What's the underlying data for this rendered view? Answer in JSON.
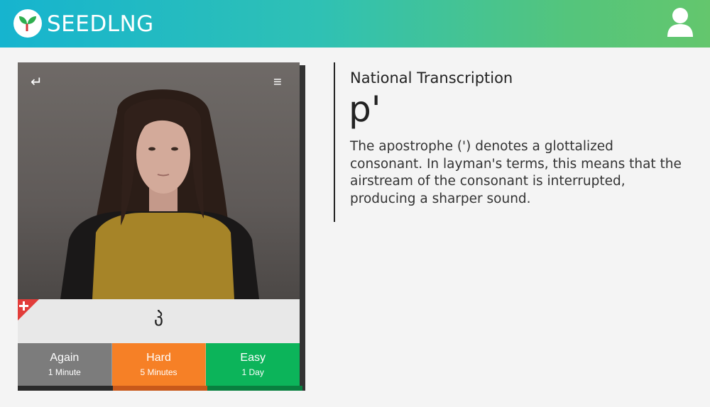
{
  "header": {
    "logo_text": "SEEDLNG",
    "logo_icon": "seedling-icon",
    "user_icon": "user-icon",
    "gradient_colors": [
      "#16b4cf",
      "#64c66d"
    ]
  },
  "card": {
    "back_icon": "return-arrow-icon",
    "menu_icon": "hamburger-menu-icon",
    "caption": "პ",
    "flag_icon": "georgian-flag-icon",
    "ratings": [
      {
        "label": "Again",
        "interval": "1 Minute",
        "color": "#7c7c7c"
      },
      {
        "label": "Hard",
        "interval": "5 Minutes",
        "color": "#f68026"
      },
      {
        "label": "Easy",
        "interval": "1 Day",
        "color": "#0cb45a"
      }
    ]
  },
  "info": {
    "title": "National Transcription",
    "letter": "p'",
    "description": "The apostrophe (') denotes a glottalized consonant. In layman's terms, this means that the airstream of the consonant is interrupted, producing a sharper sound."
  }
}
